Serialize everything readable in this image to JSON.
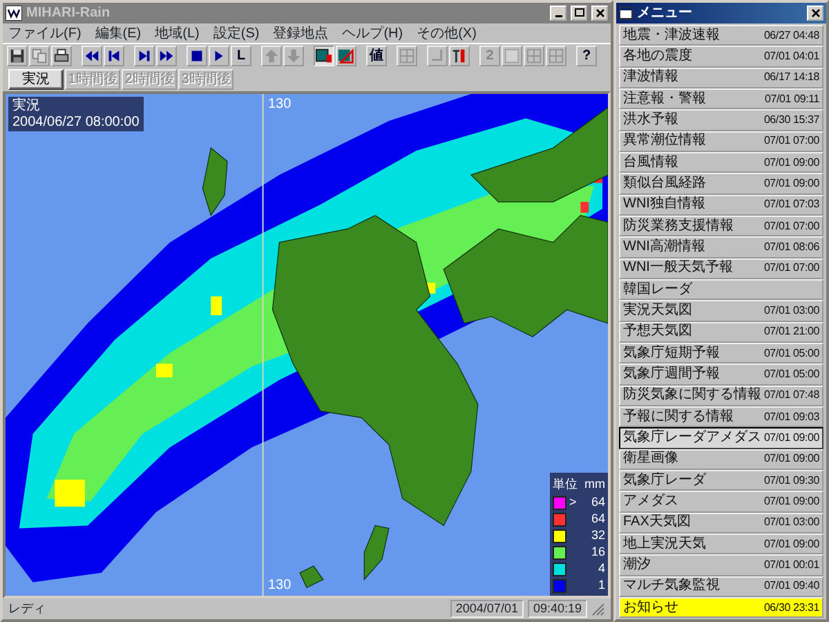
{
  "window": {
    "title": "MIHARI-Rain"
  },
  "menu_bar": [
    "ファイル(F)",
    "編集(E)",
    "地域(L)",
    "設定(S)",
    "登録地点",
    "ヘルプ(H)",
    "その他(X)"
  ],
  "toolbar": [
    {
      "kind": "save",
      "disabled": false,
      "pressed": false
    },
    {
      "kind": "copy",
      "disabled": true,
      "pressed": false
    },
    {
      "kind": "print",
      "disabled": false,
      "pressed": false
    },
    {
      "kind": "sep"
    },
    {
      "kind": "rewind",
      "disabled": false,
      "pressed": false
    },
    {
      "kind": "step_back",
      "disabled": false,
      "pressed": false
    },
    {
      "kind": "sep"
    },
    {
      "kind": "step_forward",
      "disabled": false,
      "pressed": false
    },
    {
      "kind": "fast_forward",
      "disabled": false,
      "pressed": false
    },
    {
      "kind": "sep"
    },
    {
      "kind": "stop",
      "disabled": false,
      "pressed": false
    },
    {
      "kind": "play",
      "disabled": false,
      "pressed": false
    },
    {
      "kind": "text",
      "label": "L",
      "disabled": false,
      "pressed": false
    },
    {
      "kind": "sep"
    },
    {
      "kind": "up",
      "disabled": true,
      "pressed": false
    },
    {
      "kind": "down",
      "disabled": true,
      "pressed": false
    },
    {
      "kind": "sep"
    },
    {
      "kind": "layer_screen",
      "disabled": false,
      "pressed": true
    },
    {
      "kind": "layer_triangle",
      "disabled": false,
      "pressed": false
    },
    {
      "kind": "sep"
    },
    {
      "kind": "text",
      "label": "値",
      "disabled": false,
      "pressed": false
    },
    {
      "kind": "sep"
    },
    {
      "kind": "grid",
      "disabled": true,
      "pressed": false
    },
    {
      "kind": "sep"
    },
    {
      "kind": "corner",
      "disabled": true,
      "pressed": false
    },
    {
      "kind": "tool",
      "disabled": false,
      "pressed": false
    },
    {
      "kind": "sep"
    },
    {
      "kind": "text",
      "label": "2",
      "disabled": true,
      "pressed": false
    },
    {
      "kind": "blank",
      "disabled": true,
      "pressed": false
    },
    {
      "kind": "grid",
      "disabled": true,
      "pressed": false
    },
    {
      "kind": "grid",
      "disabled": true,
      "pressed": false
    },
    {
      "kind": "sep"
    },
    {
      "kind": "text",
      "label": "?",
      "disabled": false,
      "pressed": false
    }
  ],
  "time_tabs": [
    {
      "label": "実況",
      "selected": true,
      "disabled": false
    },
    {
      "label": "1時間後",
      "selected": false,
      "disabled": true
    },
    {
      "label": "2時間後",
      "selected": false,
      "disabled": true
    },
    {
      "label": "3時間後",
      "selected": false,
      "disabled": true
    }
  ],
  "map": {
    "info_title": "実況",
    "info_time": "2004/06/27 08:00:00",
    "longitude_labels": [
      "130",
      "130"
    ],
    "legend": {
      "title": "単位",
      "unit": "mm",
      "rows": [
        {
          "prefix": ">",
          "value": "64",
          "color": "#ff00ff"
        },
        {
          "value": "64",
          "color": "#ff3030"
        },
        {
          "value": "32",
          "color": "#ffff00"
        },
        {
          "value": "16",
          "color": "#66ee55"
        },
        {
          "value": "4",
          "color": "#00e0e0"
        },
        {
          "value": "1",
          "color": "#0000ee"
        }
      ]
    }
  },
  "status_bar": {
    "message": "レディ",
    "date": "2004/07/01",
    "time": "09:40:19"
  },
  "menu_panel": {
    "title": "メニュー",
    "items": [
      {
        "label": "地震・津波速報",
        "time": "06/27 04:48",
        "selected": false,
        "highlighted": false
      },
      {
        "label": "各地の震度",
        "time": "07/01 04:01",
        "selected": false,
        "highlighted": false
      },
      {
        "label": "津波情報",
        "time": "06/17 14:18",
        "selected": false,
        "highlighted": false
      },
      {
        "label": "注意報・警報",
        "time": "07/01 09:11",
        "selected": false,
        "highlighted": false
      },
      {
        "label": "洪水予報",
        "time": "06/30 15:37",
        "selected": false,
        "highlighted": false
      },
      {
        "label": "異常潮位情報",
        "time": "07/01 07:00",
        "selected": false,
        "highlighted": false
      },
      {
        "label": "台風情報",
        "time": "07/01 09:00",
        "selected": false,
        "highlighted": false
      },
      {
        "label": "類似台風経路",
        "time": "07/01 09:00",
        "selected": false,
        "highlighted": false
      },
      {
        "label": "WNI独自情報",
        "time": "07/01 07:03",
        "selected": false,
        "highlighted": false
      },
      {
        "label": "防災業務支援情報",
        "time": "07/01 07:00",
        "selected": false,
        "highlighted": false
      },
      {
        "label": "WNI高潮情報",
        "time": "07/01 08:06",
        "selected": false,
        "highlighted": false
      },
      {
        "label": "WNI一般天気予報",
        "time": "07/01 07:00",
        "selected": false,
        "highlighted": false
      },
      {
        "label": "韓国レーダ",
        "selected": false,
        "highlighted": false
      },
      {
        "label": "実況天気図",
        "time": "07/01 03:00",
        "selected": false,
        "highlighted": false
      },
      {
        "label": "予想天気図",
        "time": "07/01 21:00",
        "selected": false,
        "highlighted": false
      },
      {
        "label": "気象庁短期予報",
        "time": "07/01 05:00",
        "selected": false,
        "highlighted": false
      },
      {
        "label": "気象庁週間予報",
        "time": "07/01 05:00",
        "selected": false,
        "highlighted": false
      },
      {
        "label": "防災気象に関する情報",
        "time": "07/01 07:48",
        "selected": false,
        "highlighted": false
      },
      {
        "label": "予報に関する情報",
        "time": "07/01 09:03",
        "selected": false,
        "highlighted": false
      },
      {
        "label": "気象庁レーダアメダス",
        "time": "07/01 09:00",
        "selected": true,
        "highlighted": false
      },
      {
        "label": "衛星画像",
        "time": "07/01 09:00",
        "selected": false,
        "highlighted": false
      },
      {
        "label": "気象庁レーダ",
        "time": "07/01 09:30",
        "selected": false,
        "highlighted": false
      },
      {
        "label": "アメダス",
        "time": "07/01 09:00",
        "selected": false,
        "highlighted": false
      },
      {
        "label": "FAX天気図",
        "time": "07/01 03:00",
        "selected": false,
        "highlighted": false
      },
      {
        "label": "地上実況天気",
        "time": "07/01 09:00",
        "selected": false,
        "highlighted": false
      },
      {
        "label": "潮汐",
        "time": "07/01 00:01",
        "selected": false,
        "highlighted": false
      },
      {
        "label": "マルチ気象監視",
        "time": "07/01 09:40",
        "selected": false,
        "highlighted": false
      },
      {
        "label": "お知らせ",
        "time": "06/30 23:31",
        "selected": false,
        "highlighted": true
      }
    ]
  }
}
